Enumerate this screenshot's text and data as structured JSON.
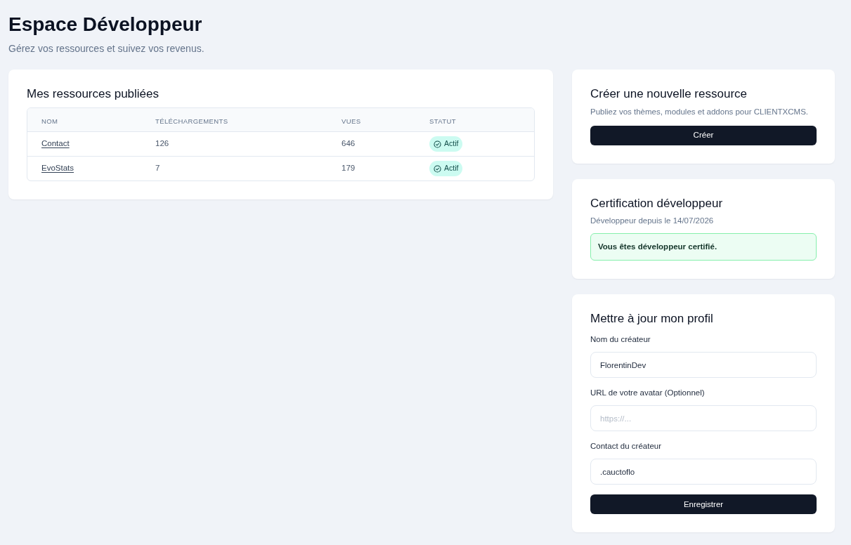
{
  "header": {
    "title": "Espace Développeur",
    "subtitle": "Gérez vos ressources et suivez vos revenus."
  },
  "resources": {
    "title": "Mes ressources publiées",
    "table": {
      "columns": [
        "NOM",
        "TÉLÉCHARGEMENTS",
        "VUES",
        "STATUT"
      ],
      "rows": [
        {
          "name": "Contact",
          "downloads": "126",
          "views": "646",
          "status": {
            "label": "Actif",
            "kind": "active"
          }
        },
        {
          "name": "EvoStats",
          "downloads": "7",
          "views": "179",
          "status": {
            "label": "Actif",
            "kind": "active"
          }
        }
      ]
    }
  },
  "create_card": {
    "title": "Créer une nouvelle ressource",
    "description": "Publiez vos thèmes, modules et addons pour CLIENTXCMS.",
    "button": "Créer"
  },
  "certification": {
    "title": "Certification développeur",
    "since": "Développeur depuis le 14/07/2026",
    "alert": {
      "kind": "success",
      "text": "Vous êtes développeur certifié."
    }
  },
  "profile": {
    "title": "Mettre à jour mon profil",
    "fields": [
      {
        "label": "Nom du créateur",
        "value": "FlorentinDev"
      },
      {
        "label": "URL de votre avatar (Optionnel)",
        "placeholder": "https://..."
      },
      {
        "label": "Contact du créateur",
        "value": ".cauctoflo"
      }
    ],
    "button": "Enregistrer"
  }
}
